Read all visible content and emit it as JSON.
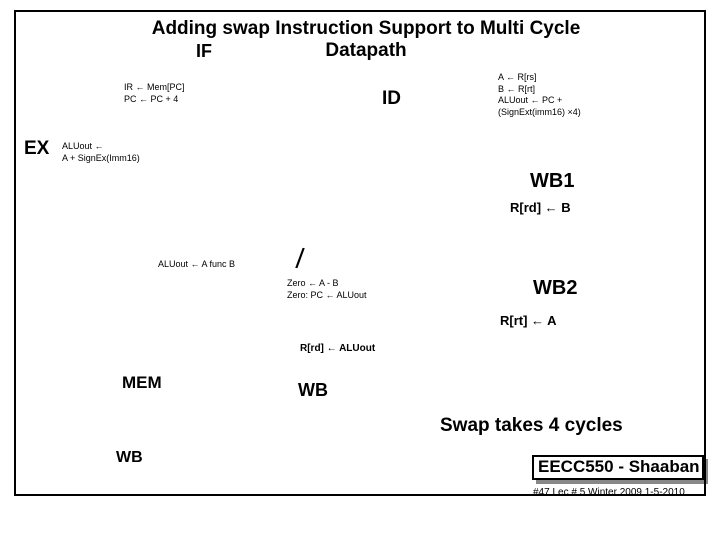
{
  "title": "Adding swap Instruction Support to Multi Cycle Datapath",
  "stages": {
    "if": "IF",
    "id": "ID",
    "ex": "EX",
    "wb1": "WB1",
    "wb2": "WB2",
    "mem": "MEM",
    "wb_center": "WB",
    "wb_bottom": "WB"
  },
  "if_code": {
    "line1": "IR ← Mem[PC]",
    "line2": "PC ← PC + 4"
  },
  "id_code": {
    "line1": "A ← R[rs]",
    "line2": "B ← R[rt]",
    "line3": "ALUout ← PC +",
    "line4": "   (SignExt(imm16) ×4)"
  },
  "ex_code": {
    "line1": "ALUout ←",
    "line2": "  A + SignEx(Imm16)"
  },
  "aluout_func": "ALUout ← A func B",
  "zero_code": {
    "line1": "Zero ← A - B",
    "line2": "Zero: PC ← ALUout"
  },
  "slash": "/",
  "rrd_b": "R[rd] ←   B",
  "rrt_a": "R[rt] ←   A",
  "rrd_aluout": "R[rd] ← ALUout",
  "swap_cycles": "Swap takes 4 cycles",
  "course": "EECC550 - Shaaban",
  "footer": "#47  Lec # 5  Winter 2009  1-5-2010"
}
